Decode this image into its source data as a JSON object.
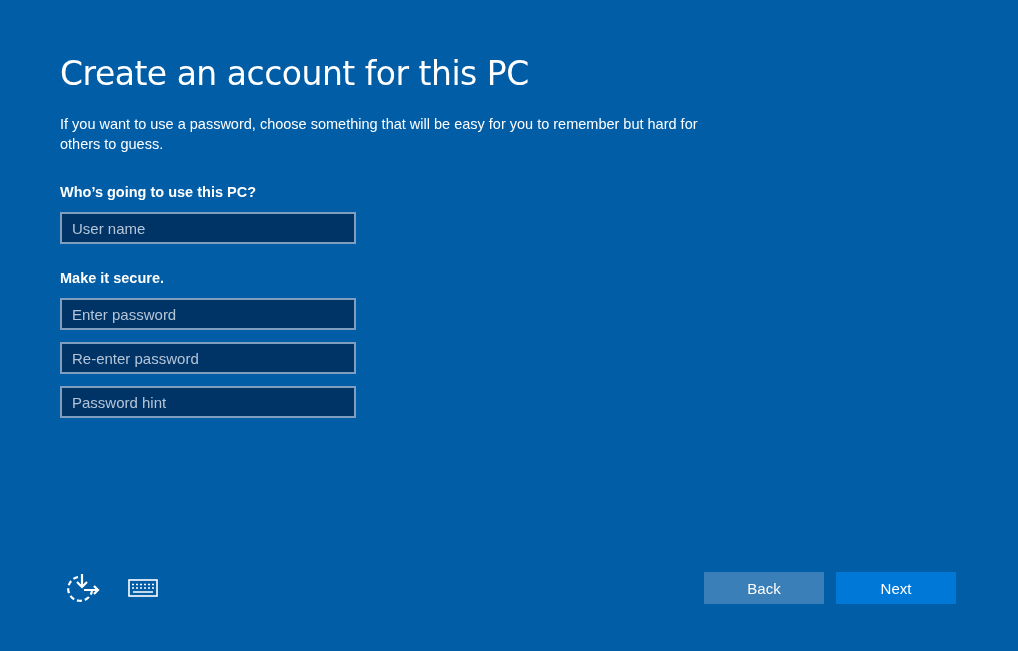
{
  "title": "Create an account for this PC",
  "description": "If you want to use a password, choose something that will be easy for you to remember but hard for others to guess.",
  "sections": [
    {
      "heading": "Who’s going to use this PC?",
      "fields": [
        {
          "placeholder": "User name"
        }
      ]
    },
    {
      "heading": "Make it secure.",
      "fields": [
        {
          "placeholder": "Enter password"
        },
        {
          "placeholder": "Re-enter password"
        },
        {
          "placeholder": "Password hint"
        }
      ]
    }
  ],
  "buttons": [
    {
      "label": "Back",
      "kind": "secondary"
    },
    {
      "label": "Next",
      "kind": "primary"
    }
  ]
}
